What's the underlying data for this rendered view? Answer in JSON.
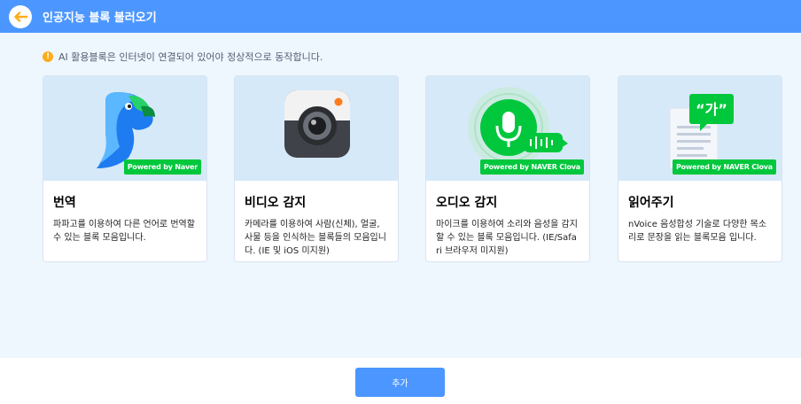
{
  "header": {
    "title": "인공지능 블록 불러오기",
    "back_icon": "back-arrow-icon"
  },
  "notice": {
    "text": "AI 활용블록은 인터넷이 연결되어 있어야 정상적으로 동작합니다.",
    "icon": "warning-icon"
  },
  "cards": [
    {
      "title": "번역",
      "badge": "Powered by Naver",
      "description": "파파고를 이용하여 다른 언어로 번역할 수 있는 블록 모음입니다.",
      "image": "papago-parrot-icon"
    },
    {
      "title": "비디오 감지",
      "badge": "",
      "description": "카메라를 이용하여 사람(신체), 얼굴, 사물 등을 인식하는 블록들의 모음입니다. (IE 및 iOS 미지원)",
      "image": "camera-icon"
    },
    {
      "title": "오디오 감지",
      "badge": "Powered by NAVER Clova",
      "description": "마이크를 이용하여 소리와 음성을 감지할 수 있는 블록 모음입니다. (IE/Safari 브라우저 미지원)",
      "image": "microphone-icon"
    },
    {
      "title": "읽어주기",
      "badge": "Powered by NAVER Clova",
      "description": "nVoice 음성합성 기술로 다양한 목소리로 문장을 읽는 블록모음 입니다.",
      "image": "speech-document-icon",
      "image_text": "“가”"
    }
  ],
  "footer": {
    "add_label": "추가"
  },
  "colors": {
    "header": "#4c97ff",
    "background": "#eef7fd",
    "badge": "#00c73c",
    "warning": "#ffab19"
  }
}
